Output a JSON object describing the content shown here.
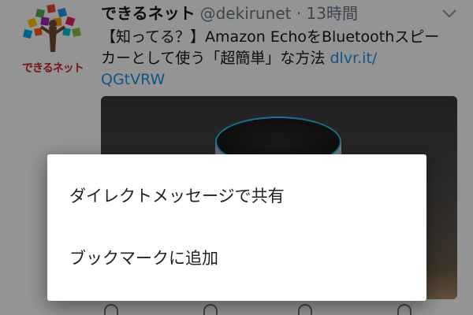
{
  "tweet": {
    "avatar_label": "できるネット",
    "display_name": "できるネット",
    "handle_time": "@dekirunet · 13時間",
    "text_line1": "【知ってる？】Amazon EchoをBluetoothスピー",
    "text_line2_plain": "カーとして使う「超簡単」な方法 ",
    "text_line2_link": "dlvr.it/",
    "text_line3_link": "QGtVRW"
  },
  "dialog": {
    "items": [
      {
        "label": "ダイレクトメッセージで共有"
      },
      {
        "label": "ブックマークに追加"
      }
    ]
  },
  "icons": {
    "avatar": "tree-logo-icon",
    "chevron": "chevron-down-icon"
  },
  "colors": {
    "scrim": "rgba(0,0,0,0.42)",
    "link": "#1b95e0",
    "echo_ring": "#1fc6ff",
    "logo_red": "#d2232a"
  }
}
